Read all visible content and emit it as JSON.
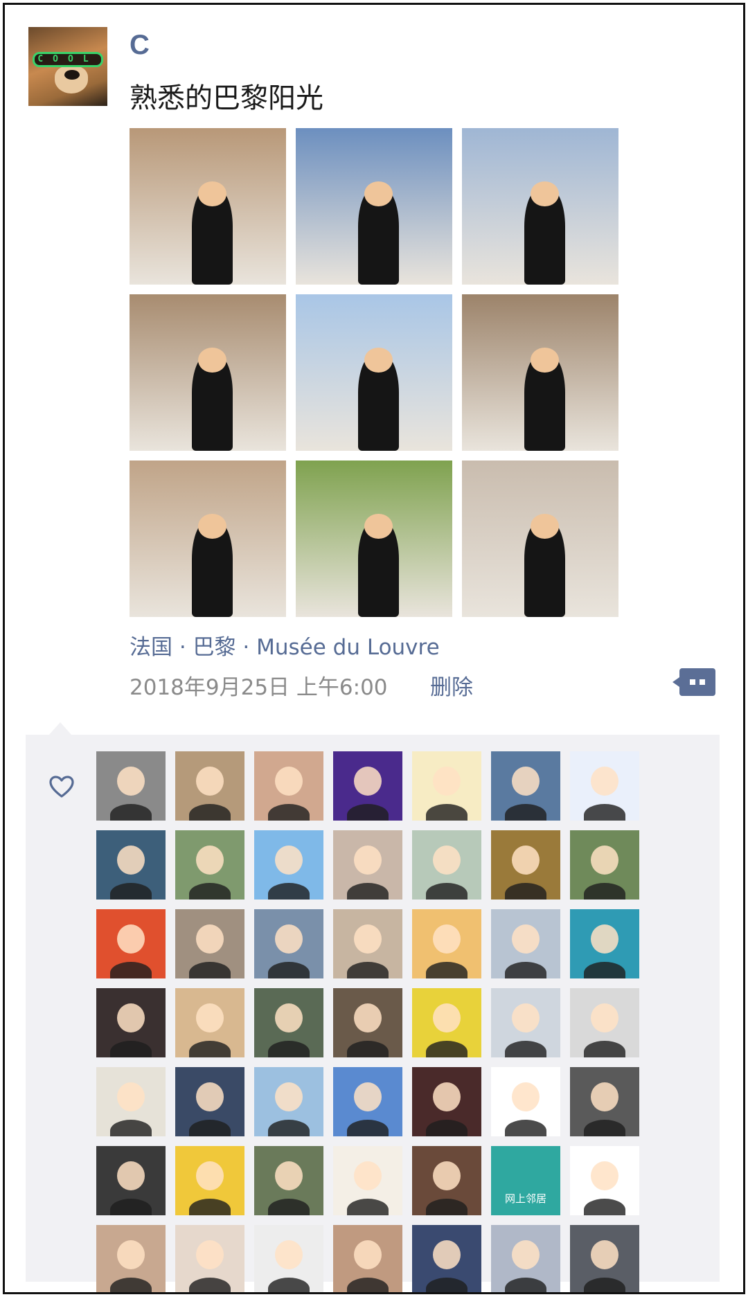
{
  "post": {
    "username": "C",
    "text": "熟悉的巴黎阳光",
    "avatar_text": "COOL",
    "location": "法国 · 巴黎 · Musée du Louvre",
    "timestamp": "2018年9月25日 上午6:00",
    "delete_label": "删除",
    "photos": [
      {
        "name": "colonnade-portrait",
        "bg": "#b89878"
      },
      {
        "name": "louvre-palace-selfie",
        "bg": "#6c8fbf"
      },
      {
        "name": "glass-pyramid-portrait",
        "bg": "#9fb6d4"
      },
      {
        "name": "arcade-lean-portrait",
        "bg": "#a88c70"
      },
      {
        "name": "pyramid-sky-selfie",
        "bg": "#a9c6e6"
      },
      {
        "name": "arcade-sitting-portrait",
        "bg": "#9c836a"
      },
      {
        "name": "colonnade-pose-portrait",
        "bg": "#c0a488"
      },
      {
        "name": "garden-back-view",
        "bg": "#7fa24f"
      },
      {
        "name": "palace-facade-portrait",
        "bg": "#c9bcae"
      }
    ]
  },
  "likes": {
    "heart_icon": "heart-outline-icon",
    "avatars": [
      {
        "bg": "#8a8a8a"
      },
      {
        "bg": "#b59a7a"
      },
      {
        "bg": "#d1a88f"
      },
      {
        "bg": "#4a2a8c"
      },
      {
        "bg": "#f7ecc4"
      },
      {
        "bg": "#5a7aa0"
      },
      {
        "bg": "#eaf0fb"
      },
      {
        "bg": "#3d5f7a"
      },
      {
        "bg": "#7f9a6e"
      },
      {
        "bg": "#7fb9e8"
      },
      {
        "bg": "#c9b7a9"
      },
      {
        "bg": "#b7c9b9"
      },
      {
        "bg": "#9a7a3a"
      },
      {
        "bg": "#6f8a5a"
      },
      {
        "bg": "#e0502e"
      },
      {
        "bg": "#a09080"
      },
      {
        "bg": "#7a90aa"
      },
      {
        "bg": "#c7b5a1"
      },
      {
        "bg": "#f0c070"
      },
      {
        "bg": "#b8c4d2"
      },
      {
        "bg": "#2f9bb4"
      },
      {
        "bg": "#3a3030"
      },
      {
        "bg": "#d8b890"
      },
      {
        "bg": "#5a6a55"
      },
      {
        "bg": "#6a5a4a"
      },
      {
        "bg": "#e8d23a"
      },
      {
        "bg": "#cfd6de"
      },
      {
        "bg": "#d9d9d9"
      },
      {
        "bg": "#e6e2d8"
      },
      {
        "bg": "#3a4a66"
      },
      {
        "bg": "#9cc0e0"
      },
      {
        "bg": "#5a8ad0"
      },
      {
        "bg": "#4a2a2a"
      },
      {
        "bg": "#ffffff"
      },
      {
        "bg": "#5a5a5a"
      },
      {
        "bg": "#3a3a3a"
      },
      {
        "bg": "#f0c83a"
      },
      {
        "bg": "#6a7a5a"
      },
      {
        "bg": "#f4efe6"
      },
      {
        "bg": "#6a4a3a"
      },
      {
        "bg": "#2fa8a0",
        "text": "网上邻居"
      },
      {
        "bg": "#ffffff"
      },
      {
        "bg": "#c8a890"
      },
      {
        "bg": "#e6d8cc"
      },
      {
        "bg": "#ededed"
      },
      {
        "bg": "#c09a80"
      },
      {
        "bg": "#3a4a70"
      },
      {
        "bg": "#b0b8c8"
      },
      {
        "bg": "#5a5e66"
      }
    ]
  },
  "colors": {
    "link_blue": "#566b94",
    "time_gray": "#8a8a8a",
    "panel_bg": "#f1f1f4"
  }
}
